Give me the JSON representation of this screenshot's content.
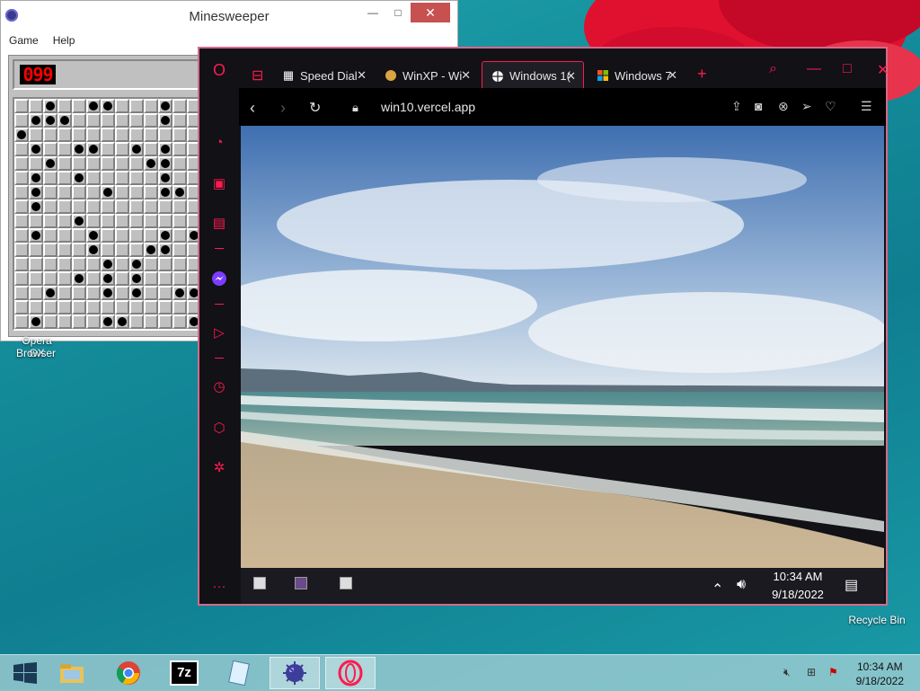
{
  "minesweeper": {
    "title": "Minesweeper",
    "menu": [
      "Game",
      "Help"
    ],
    "counter": "099",
    "window_buttons": {
      "minimize": "—",
      "maximize": "□",
      "close": "✕"
    },
    "grid": {
      "cols": 13,
      "rows": 16,
      "mines": [
        [
          0,
          2
        ],
        [
          0,
          5
        ],
        [
          0,
          6
        ],
        [
          0,
          10
        ],
        [
          1,
          1
        ],
        [
          1,
          2
        ],
        [
          1,
          3
        ],
        [
          1,
          10
        ],
        [
          2,
          0
        ],
        [
          3,
          1
        ],
        [
          3,
          4
        ],
        [
          3,
          5
        ],
        [
          3,
          8
        ],
        [
          3,
          10
        ],
        [
          4,
          2
        ],
        [
          4,
          9
        ],
        [
          4,
          10
        ],
        [
          5,
          1
        ],
        [
          5,
          4
        ],
        [
          5,
          10
        ],
        [
          6,
          1
        ],
        [
          6,
          6
        ],
        [
          6,
          10
        ],
        [
          6,
          11
        ],
        [
          7,
          1
        ],
        [
          8,
          4
        ],
        [
          9,
          1
        ],
        [
          9,
          5
        ],
        [
          9,
          10
        ],
        [
          9,
          12
        ],
        [
          10,
          5
        ],
        [
          10,
          9
        ],
        [
          10,
          10
        ],
        [
          11,
          6
        ],
        [
          11,
          8
        ],
        [
          12,
          4
        ],
        [
          12,
          6
        ],
        [
          12,
          8
        ],
        [
          13,
          2
        ],
        [
          13,
          6
        ],
        [
          13,
          8
        ],
        [
          13,
          11
        ],
        [
          13,
          12
        ],
        [
          15,
          1
        ],
        [
          15,
          6
        ],
        [
          15,
          7
        ],
        [
          15,
          12
        ]
      ]
    }
  },
  "desktop": {
    "opera_label_fragment": "Opera GX",
    "opera_label": "Browser",
    "recycle_bin_label": "Recycle Bin"
  },
  "opera": {
    "tabs": [
      {
        "label": "Speed Dial",
        "icon": "grid-icon",
        "active": false
      },
      {
        "label": "WinXP - Wi",
        "icon": "doge-icon",
        "active": false
      },
      {
        "label": "Windows 1(",
        "icon": "globe-icon",
        "active": true
      },
      {
        "label": "Windows 7",
        "icon": "windows-flag-icon",
        "active": false
      }
    ],
    "new_tab": "+",
    "address": "win10.vercel.app",
    "accent": "#ff1b4d",
    "border_color": "#d46a8a",
    "inner_taskbar": {
      "time": "10:34 AM",
      "date": "9/18/2022"
    }
  },
  "taskbar": {
    "time": "10:34 AM",
    "date": "9/18/2022",
    "apps": [
      "start-button",
      "file-explorer",
      "chrome",
      "7zip",
      "notepad",
      "minesweeper",
      "opera"
    ]
  }
}
